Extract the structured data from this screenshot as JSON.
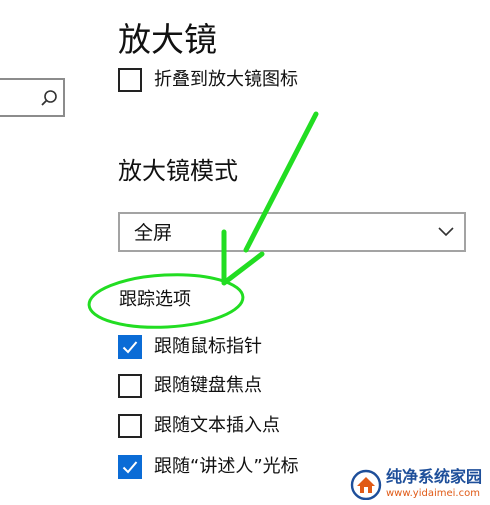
{
  "header": {
    "title": "放大镜"
  },
  "options": {
    "collapse_to_icon": {
      "label": "折叠到放大镜图标",
      "checked": false
    }
  },
  "mode": {
    "title": "放大镜模式",
    "selected": "全屏"
  },
  "tracking": {
    "title": "跟踪选项",
    "items": [
      {
        "label": "跟随鼠标指针",
        "checked": true
      },
      {
        "label": "跟随键盘焦点",
        "checked": false
      },
      {
        "label": "跟随文本插入点",
        "checked": false
      },
      {
        "label": "跟随“讲述人”光标",
        "checked": true
      }
    ]
  },
  "watermark": {
    "title": "纯净系统家园",
    "url": "www.yidaimei.com"
  },
  "colors": {
    "checkbox_accent": "#0b6cd6",
    "annotation_green": "#22dd22",
    "watermark_blue": "#1e4f9a",
    "watermark_orange": "#e05a16"
  },
  "icons": {
    "search": "search-icon",
    "chevron": "chevron-down-icon",
    "check": "checkmark-icon",
    "annotation": "green-arrow-icon"
  }
}
